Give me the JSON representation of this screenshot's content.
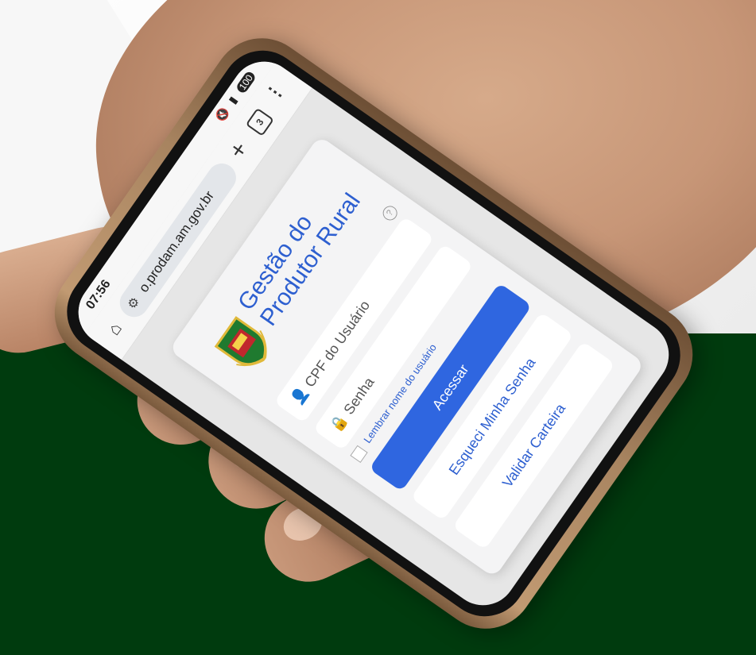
{
  "statusbar": {
    "time": "07:56",
    "battery": "100"
  },
  "browser": {
    "url": "o.prodam.am.gov.br",
    "tab_count": "3",
    "icons": [
      "home-icon",
      "tune-icon",
      "plus-icon",
      "tabs-icon",
      "menu-icon"
    ]
  },
  "login": {
    "title": "Gestão do Produtor Rural",
    "help_symbol": "?",
    "cpf_placeholder": "CPF do Usuário",
    "password_placeholder": "Senha",
    "remember_label": "Lembrar nome do usuário",
    "submit_label": "Acessar",
    "forgot_label": "Esqueci Minha Senha",
    "validate_label": "Validar Carteira"
  },
  "colors": {
    "brand_blue": "#2f66e0",
    "background_green": "#003b0e"
  }
}
